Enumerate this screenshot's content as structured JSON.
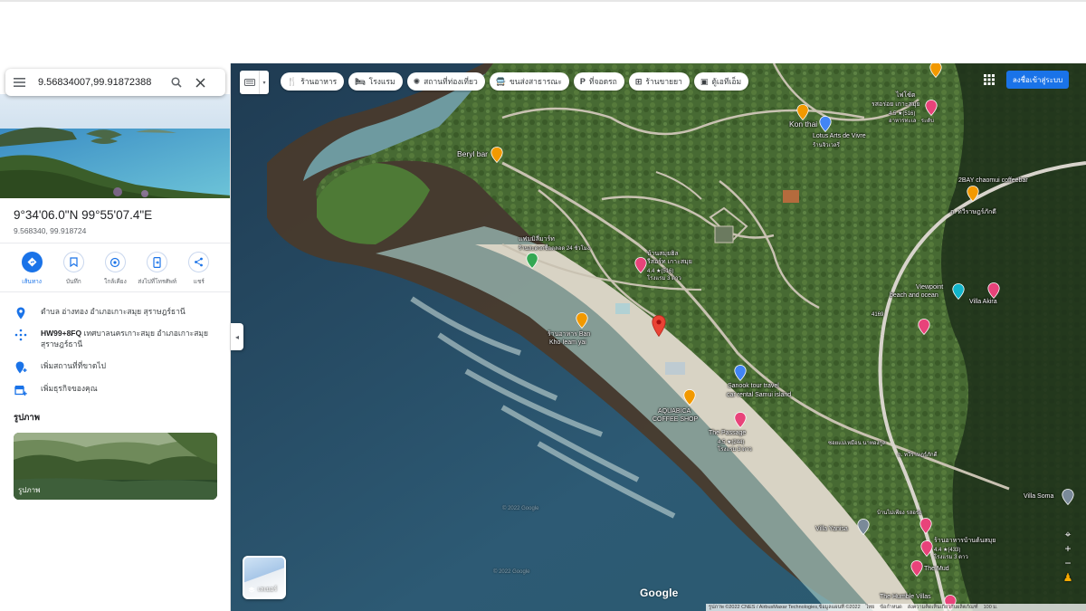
{
  "search": {
    "value": "9.56834007,99.91872388"
  },
  "place": {
    "coords_dms": "9°34'06.0\"N 99°55'07.4\"E",
    "coords_decimal": "9.568340, 99.918724"
  },
  "actions": [
    {
      "label": "เส้นทาง",
      "icon": "directions-icon"
    },
    {
      "label": "บันทึก",
      "icon": "bookmark-icon"
    },
    {
      "label": "ใกล้เคียง",
      "icon": "nearby-icon"
    },
    {
      "label": "ส่งไปที่โทรศัพท์",
      "icon": "send-to-phone-icon"
    },
    {
      "label": "แชร์",
      "icon": "share-icon"
    }
  ],
  "info": {
    "address": "ตำบล อ่างทอง อำเภอเกาะสมุย สุราษฎร์ธานี",
    "pluscode_bold": "HW99+8FQ",
    "pluscode_rest": " เทศบาลนครเกาะสมุย อำเภอเกาะสมุย สุราษฎร์ธานี",
    "add_missing": "เพิ่มสถานที่ที่ขาดไป",
    "add_business": "เพิ่มธุรกิจของคุณ"
  },
  "photos": {
    "title": "รูปภาพ",
    "caption": "รูปภาพ"
  },
  "map": {
    "chips": [
      {
        "icon": "🍴",
        "label": "ร้านอาหาร"
      },
      {
        "icon": "🛏",
        "label": "โรงแรม"
      },
      {
        "icon": "✺",
        "label": "สถานที่ท่องเที่ยว"
      },
      {
        "icon": "🚍",
        "label": "ขนส่งสาธารณะ"
      },
      {
        "icon": "P",
        "label": "ที่จอดรถ"
      },
      {
        "icon": "⊞",
        "label": "ร้านขายยา"
      },
      {
        "icon": "▣",
        "label": "ตู้เอทีเอ็ม"
      }
    ],
    "signin": "ลงชื่อเข้าสู่ระบบ",
    "layers_label": "เลเยอร์",
    "google": "Google",
    "footer": {
      "imagery": "รูปภาพ ©2022 CNES / AirbusMaxar Technologies,ข้อมูลแผนที่ ©2022",
      "terms": "ไทย",
      "privacy": "ข้อกำหนด",
      "feedback": "ส่งความคิดเห็นเกี่ยวกับผลิตภัณฑ์",
      "scale": "100 ม."
    },
    "places": {
      "kon_thai": "Kon thai",
      "lotus": "Lotus Arts de Vivre",
      "lotus_sub": "ร้านจิวเวลรี่",
      "beryl": "Beryl bar",
      "phai_l1": "ไฟโซ้ต",
      "phai_l2": "รสอร่อย เกาะสมุย",
      "phai_rating": "4.5 ★(516)",
      "phai_sub": "อาหารทะเล · ระดับ",
      "bay": "2BAY chaomui coffeebar",
      "road_right": "ถ. ทวีราษฎร์ภักดี",
      "road_right2": "ถ. ทวีราษฎร์ภักดี",
      "road_num": "4169",
      "viewpoint_l1": "Viewpoint",
      "viewpoint_l2": "beach and ocean",
      "villa_akira": "Villa Akira",
      "shop_green_l1": "แฟมมิลี่มาร์ท",
      "shop_green_l2": "ร้านสะดวกซื้อตลอด 24 ชั่วโมง",
      "hotel_l1": "บ้านสมุยฮิล",
      "hotel_l2": "รีสอร์ท เกาะสมุย",
      "hotel_rating": "4.4 ★(516)",
      "hotel_sub": "โรงแรม 3 ดาว",
      "pub_l1": "ร้านอาหาร Ban",
      "pub_l2": "Kho Ieam yai",
      "sanook_l1": "Sanook tour travel",
      "sanook_l2": "car rental Samui island",
      "aqua_l1": "AQUABICA",
      "aqua_l2": "COFFEE SHOP",
      "passage": "The Passage",
      "passage_rating": "4.5 ★(244)",
      "passage_sub": "โรงแรม 3 ดาว",
      "soi": "ซอยแม่เหมือน นาทองกูล",
      "villa_soma": "Villa Soma",
      "villa_yanisa": "Villa Yanisa",
      "rest_mid": "บ้านไม่เพียง รสอร่อ",
      "rest_l1": "ร้านอาหารบ้านต้นสมุย",
      "rest_rating": "4.4 ★(433)",
      "rest_sub": "โรงแรม 3 ดาว",
      "the_mud": "The Mud",
      "humble": "The Humble Villas",
      "wm1": "© 2022 Google",
      "wm2": "© 2022 Google"
    }
  },
  "colors": {
    "accent": "#1a73e8",
    "pin_red": "#ea4335",
    "pin_orange": "#f29900",
    "pin_pink": "#e8437a",
    "pin_blue": "#4285f4",
    "pin_green": "#34a853"
  }
}
